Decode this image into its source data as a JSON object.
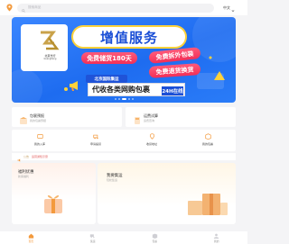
{
  "search": {
    "placeholder": "搜索商品"
  },
  "language": {
    "label": "中文"
  },
  "banner": {
    "title": "增值服务",
    "logo_name": "北京光行",
    "logo_sub": "Guanghang",
    "tags": [
      "免费储货180天",
      "免费拆外包装",
      "免费退货换货"
    ],
    "sub_tag": "北京国际集运",
    "strip_text": "代收各类网购包裹",
    "strip_badge": "24H在线",
    "slides": 5,
    "active_slide": 3
  },
  "cards": [
    {
      "title": "包裹预报",
      "sub": "我的包裹预报"
    },
    {
      "title": "运费试算",
      "sub": "运费查询"
    }
  ],
  "quick_nav": [
    "我的入库",
    "申请提货",
    "收货地址",
    "我的包裹"
  ],
  "notice": {
    "label": "公告",
    "text": "运营通知示意"
  },
  "promos": [
    {
      "title": "福利优惠",
      "sub": "新客福利"
    },
    {
      "title": "我要集运",
      "sub": "轻松集运"
    }
  ],
  "tabbar": [
    {
      "label": "首页",
      "active": true
    },
    {
      "label": "集运",
      "active": false
    },
    {
      "label": "包裹",
      "active": false
    },
    {
      "label": "我的",
      "active": false
    }
  ],
  "colors": {
    "accent": "#f39a3d",
    "banner_blue": "#1e6cf0",
    "tag_red": "#f23058",
    "title_yellow": "#ffd23a"
  }
}
